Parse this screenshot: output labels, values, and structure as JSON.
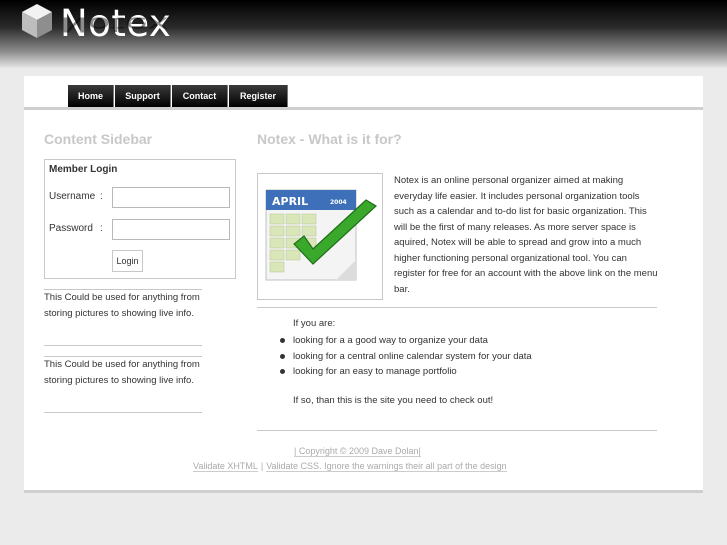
{
  "header": {
    "logo_text": "Notex"
  },
  "nav": {
    "items": [
      "Home",
      "Support",
      "Contact",
      "Register"
    ]
  },
  "sidebar": {
    "title": "Content Sidebar",
    "login": {
      "title": "Member Login",
      "username_label": "Username",
      "password_label": "Password",
      "separator": ":",
      "username_value": "",
      "password_value": "",
      "button_label": "Login"
    },
    "notes": [
      "This Could be used for anything from storing pictures to showing live info.",
      "This Could be used for anything from storing pictures to showing live info."
    ]
  },
  "main": {
    "title": "Notex - What is it for?",
    "calendar_month": "APRIL",
    "calendar_year": "2004",
    "intro": "Notex is an online personal organizer aimed at making everyday life easier. It includes personal organization tools such as a calendar and to-do list for basic organization. This will be the first of many releases. As more server space is aquired, Notex will be able to spread and grow into a much higher functioning personal organizational tool. You can register for free for an account with the above link on the menu bar.",
    "if_you_are": "If you are:",
    "bullets": [
      "looking for a a good way to organize your data",
      "looking for a central online calendar system for your data",
      "looking for an easy to manage portfolio"
    ],
    "closing": "If so, than this is the site you need to check out!"
  },
  "footer": {
    "copyright": "| Copyright © 2009 Dave Dolan|",
    "validate_xhtml": "Validate XHTML",
    "pipe": "|",
    "validate_css": "Validate CSS. Ignore the warnings their all part of the design"
  }
}
